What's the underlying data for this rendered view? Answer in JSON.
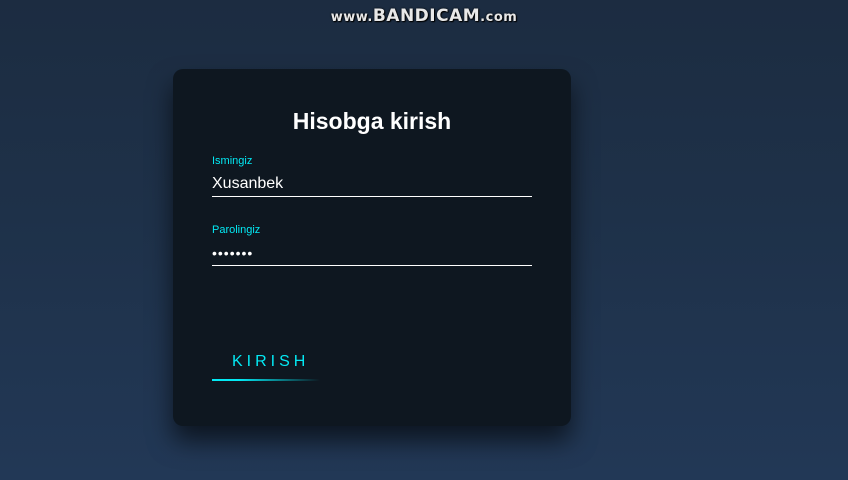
{
  "watermark": {
    "prefix": "www.",
    "brand": "BANDICAM",
    "suffix": ".com"
  },
  "login": {
    "title": "Hisobga kirish",
    "username": {
      "label": "Ismingiz",
      "value": "Xusanbek"
    },
    "password": {
      "label": "Parolingiz",
      "value": "•••••••"
    },
    "submit_label": "KIRISH"
  },
  "colors": {
    "accent": "#03e9f4",
    "card_background": "#0e1720",
    "page_background": "#1e3149"
  }
}
